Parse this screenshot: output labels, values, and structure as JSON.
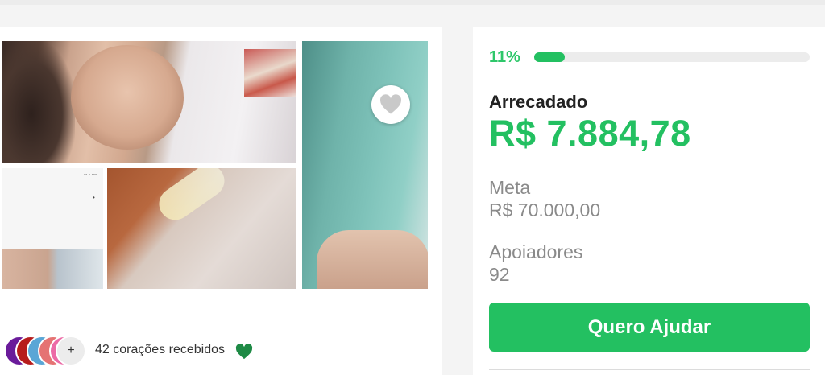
{
  "gallery": {
    "photos": [
      {
        "name": "photo-woman-in-bed"
      },
      {
        "name": "photo-document"
      },
      {
        "name": "photo-bandaged-arm"
      },
      {
        "name": "photo-hospital-curtain"
      }
    ],
    "heart_icon": "heart-icon"
  },
  "supporters": {
    "avatars": [
      {
        "initial": "",
        "color": "#6a1b9a"
      },
      {
        "initial": "S",
        "color": "#b71c1c"
      },
      {
        "initial": "S",
        "color": "#5aa6d6"
      },
      {
        "initial": "",
        "color": "#e57373"
      },
      {
        "initial": "M",
        "color": "#ec6aa6"
      }
    ],
    "more_label": "+",
    "hearts_text": "42 corações recebidos",
    "hearts_icon": "green-heart-icon",
    "hearts_color": "#1e8a45"
  },
  "progress": {
    "percent_label": "11%",
    "percent_value": 11
  },
  "stats": {
    "raised_label": "Arrecadado",
    "raised_value": "R$ 7.884,78",
    "goal_label": "Meta",
    "goal_value": "R$ 70.000,00",
    "backers_label": "Apoiadores",
    "backers_value": "92"
  },
  "cta": {
    "label": "Quero Ajudar"
  },
  "colors": {
    "accent": "#23c061",
    "text": "#222222",
    "muted": "#8a8a8a"
  }
}
